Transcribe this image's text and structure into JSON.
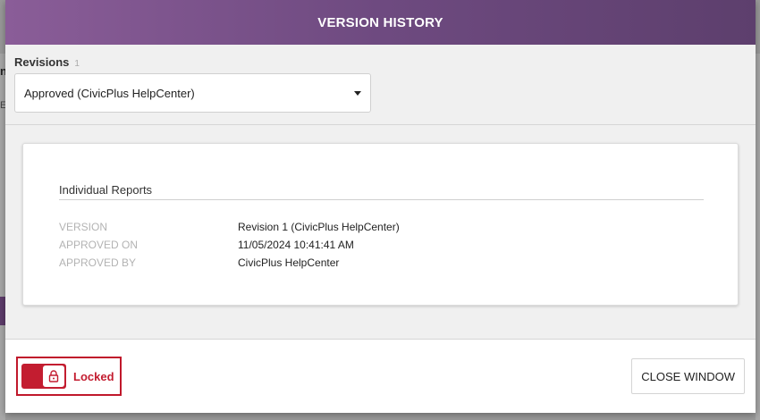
{
  "background": {
    "partial_letter_1": "n",
    "partial_letter_2": "E"
  },
  "modal": {
    "title": "VERSION HISTORY",
    "revisions": {
      "label": "Revisions",
      "count": "1",
      "selected": "Approved (CivicPlus HelpCenter)"
    },
    "report": {
      "title": "Individual Reports",
      "fields": [
        {
          "key": "VERSION",
          "value": "Revision 1 (CivicPlus HelpCenter)"
        },
        {
          "key": "APPROVED ON",
          "value": "11/05/2024 10:41:41 AM"
        },
        {
          "key": "APPROVED BY",
          "value": "CivicPlus HelpCenter"
        }
      ]
    },
    "footer": {
      "lock_label": "Locked",
      "lock_icon": "lock-icon",
      "close_label": "CLOSE WINDOW"
    }
  },
  "colors": {
    "header_start": "#8a5d98",
    "header_end": "#5d3f6d",
    "lock_red": "#c31d30"
  }
}
